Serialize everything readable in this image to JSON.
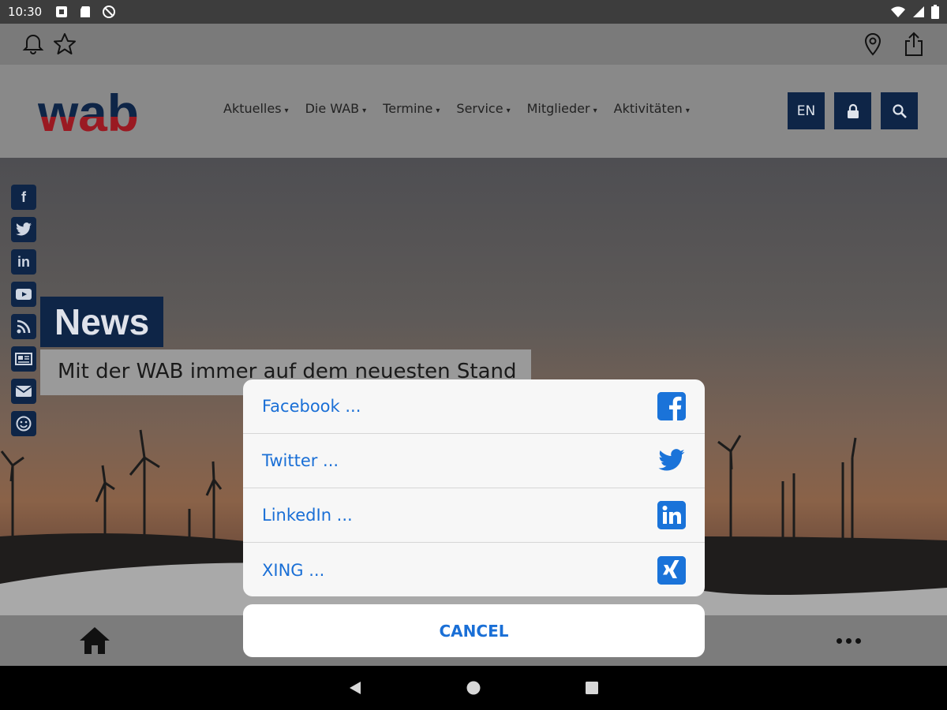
{
  "status_bar": {
    "time": "10:30"
  },
  "site": {
    "logo": "wab",
    "nav": [
      {
        "label": "Aktuelles"
      },
      {
        "label": "Die WAB"
      },
      {
        "label": "Termine"
      },
      {
        "label": "Service"
      },
      {
        "label": "Mitglieder"
      },
      {
        "label": "Aktivitäten"
      }
    ],
    "lang_button": "EN"
  },
  "hero": {
    "title": "News",
    "subtitle": "Mit der WAB immer auf dem neuesten Stand"
  },
  "share_sheet": {
    "options": [
      {
        "label": "Facebook ...",
        "icon": "facebook-icon"
      },
      {
        "label": "Twitter ...",
        "icon": "twitter-icon"
      },
      {
        "label": "LinkedIn ...",
        "icon": "linkedin-icon"
      },
      {
        "label": "XING ...",
        "icon": "xing-icon"
      }
    ],
    "cancel_label": "CANCEL"
  },
  "colors": {
    "brand_navy": "#0e2547",
    "link_blue": "#1a6fd6",
    "sheet_bg": "#f7f7f7"
  }
}
